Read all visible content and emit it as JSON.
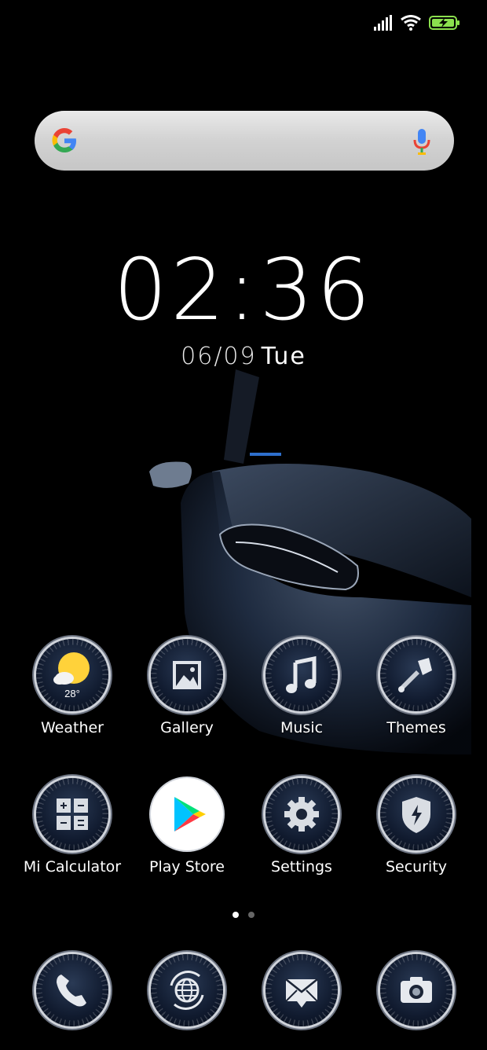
{
  "status": {
    "signal_icon": "signal-bars-icon",
    "wifi_icon": "wifi-icon",
    "battery_icon": "battery-charging-icon",
    "battery_color": "#8be04e"
  },
  "search": {
    "logo_icon": "google-g-icon",
    "mic_icon": "microphone-icon"
  },
  "clock": {
    "time": "02:36",
    "date": "06/09",
    "weekday": "Tue"
  },
  "apps": [
    {
      "label": "Weather",
      "icon": "weather-sun-cloud-icon",
      "badge": "28°"
    },
    {
      "label": "Gallery",
      "icon": "gallery-icon"
    },
    {
      "label": "Music",
      "icon": "music-note-icon"
    },
    {
      "label": "Themes",
      "icon": "paintbrush-icon"
    },
    {
      "label": "Mi Calculator",
      "icon": "calculator-icon"
    },
    {
      "label": "Play Store",
      "icon": "play-store-icon"
    },
    {
      "label": "Settings",
      "icon": "gear-icon"
    },
    {
      "label": "Security",
      "icon": "shield-icon"
    }
  ],
  "page_indicator": {
    "pages": 2,
    "active": 1
  },
  "dock": [
    {
      "icon": "phone-icon"
    },
    {
      "icon": "browser-globe-icon"
    },
    {
      "icon": "messaging-envelope-icon"
    },
    {
      "icon": "camera-icon"
    }
  ]
}
